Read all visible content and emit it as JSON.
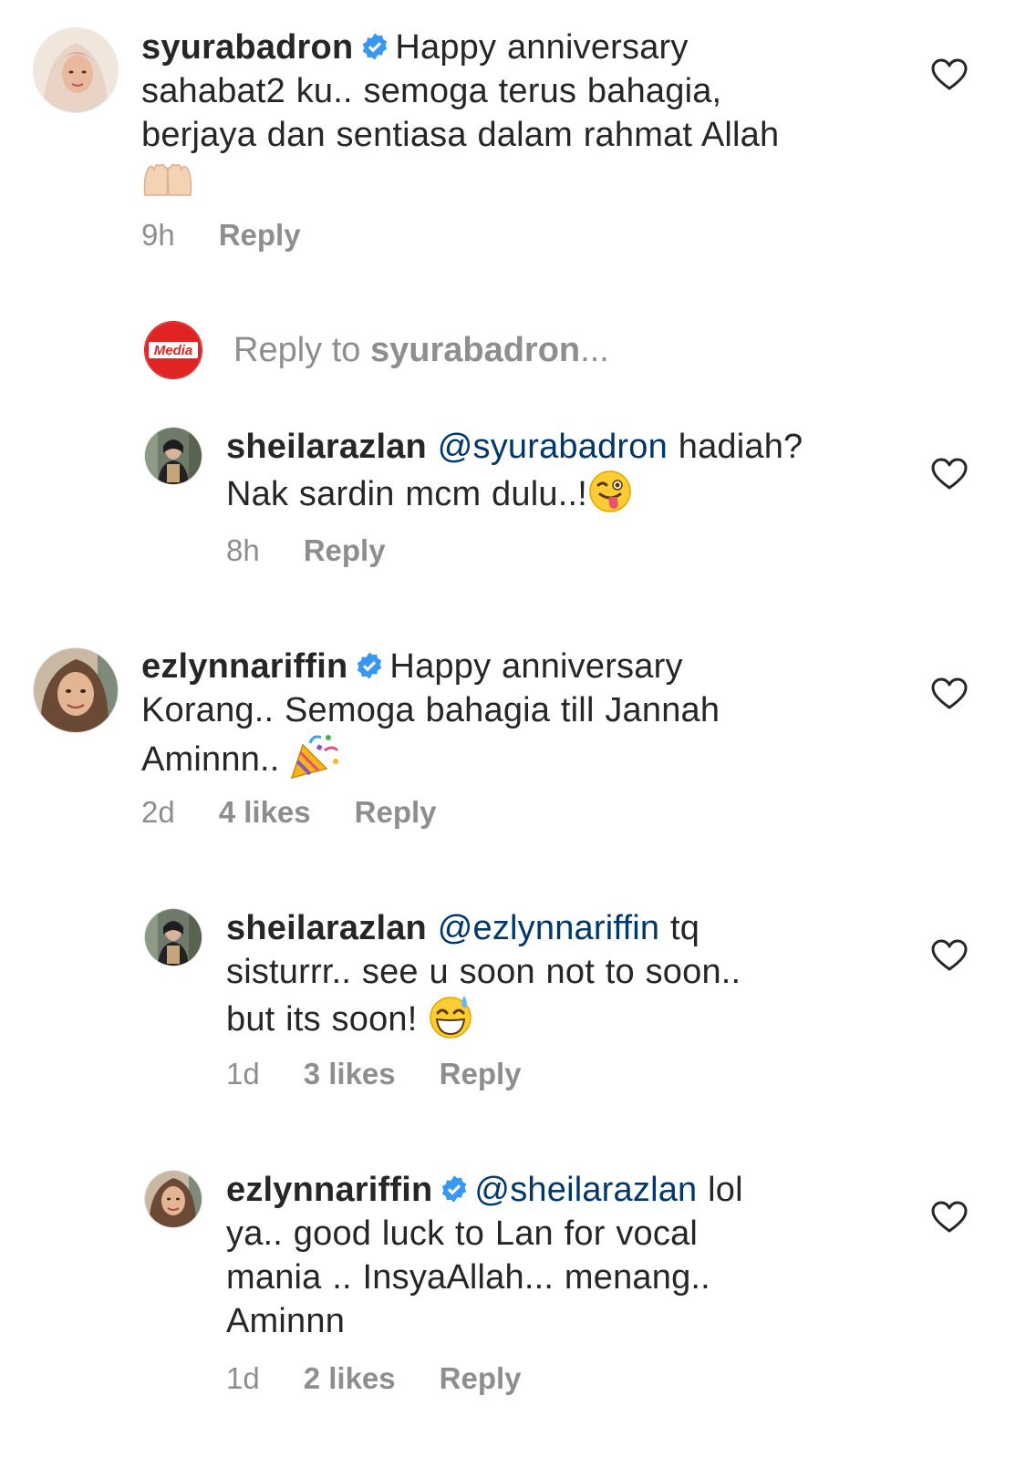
{
  "colors": {
    "text": "#262626",
    "meta": "#8e8e8e",
    "mention": "#00376b",
    "verified": "#3897f0",
    "brand_red": "#e02424"
  },
  "icons": {
    "like": "heart-outline-icon",
    "verified": "verified-badge-icon"
  },
  "comments": [
    {
      "username": "syurabadron",
      "verified": true,
      "lines": [
        "Happy anniversary",
        "sahabat2 ku.. semoga terus bahagia,",
        "berjaya dan sentiasa dalam rahmat Allah"
      ],
      "emoji": "raising-hands-emoji",
      "time": "9h",
      "likes": "",
      "reply_label": "Reply"
    },
    {
      "username": "sheilarazlan",
      "mention": "@syurabadron",
      "lines": [
        "hadiah?",
        "Nak sardin mcm dulu..!"
      ],
      "emoji": "winking-face-tongue-emoji",
      "time": "8h",
      "likes": "",
      "reply_label": "Reply"
    },
    {
      "username": "ezlynnariffin",
      "verified": true,
      "lines": [
        "Happy anniversary",
        "Korang.. Semoga bahagia till Jannah",
        "Aminnn.."
      ],
      "emoji": "party-popper-emoji",
      "time": "2d",
      "likes": "4 likes",
      "reply_label": "Reply"
    },
    {
      "username": "sheilarazlan",
      "mention": "@ezlynnariffin",
      "lines": [
        "tq",
        "sisturrr.. see u soon not to soon..",
        "but its soon!"
      ],
      "emoji": "grinning-sweat-emoji",
      "time": "1d",
      "likes": "3 likes",
      "reply_label": "Reply"
    },
    {
      "username": "ezlynnariffin",
      "verified": true,
      "mention": "@sheilarazlan",
      "lines": [
        "lol",
        "ya.. good luck to Lan for vocal",
        "mania .. InsyaAllah... menang..",
        "Aminnn"
      ],
      "time": "1d",
      "likes": "2 likes",
      "reply_label": "Reply"
    }
  ],
  "reply_input": {
    "prefix": "Reply to ",
    "target": "syurabadron",
    "suffix": "...",
    "avatar_logo_text": "Media"
  }
}
